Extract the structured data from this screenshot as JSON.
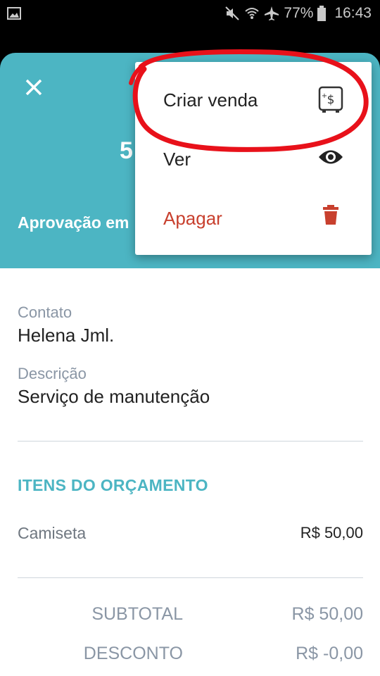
{
  "status_bar": {
    "battery": "77%",
    "time": "16:43"
  },
  "header": {
    "amount_partial": "5",
    "status_partial": "Aprovação em"
  },
  "menu": {
    "items": [
      {
        "label": "Criar venda",
        "icon": "cash-register-icon"
      },
      {
        "label": "Ver",
        "icon": "eye-icon"
      },
      {
        "label": "Apagar",
        "icon": "trash-icon",
        "color": "#c8402e"
      }
    ]
  },
  "details": {
    "contact_label": "Contato",
    "contact_value": "Helena Jml.",
    "description_label": "Descrição",
    "description_value": "Serviço de manutenção"
  },
  "items_section": {
    "title": "ITENS DO ORÇAMENTO",
    "items": [
      {
        "name": "Camiseta",
        "price": "R$ 50,00"
      }
    ]
  },
  "totals": {
    "subtotal_label": "SUBTOTAL",
    "subtotal_value": "R$ 50,00",
    "discount_label": "DESCONTO",
    "discount_value": "R$ -0,00"
  },
  "colors": {
    "accent": "#4cb5c3",
    "danger": "#c8402e",
    "annotation": "#e8111a"
  }
}
